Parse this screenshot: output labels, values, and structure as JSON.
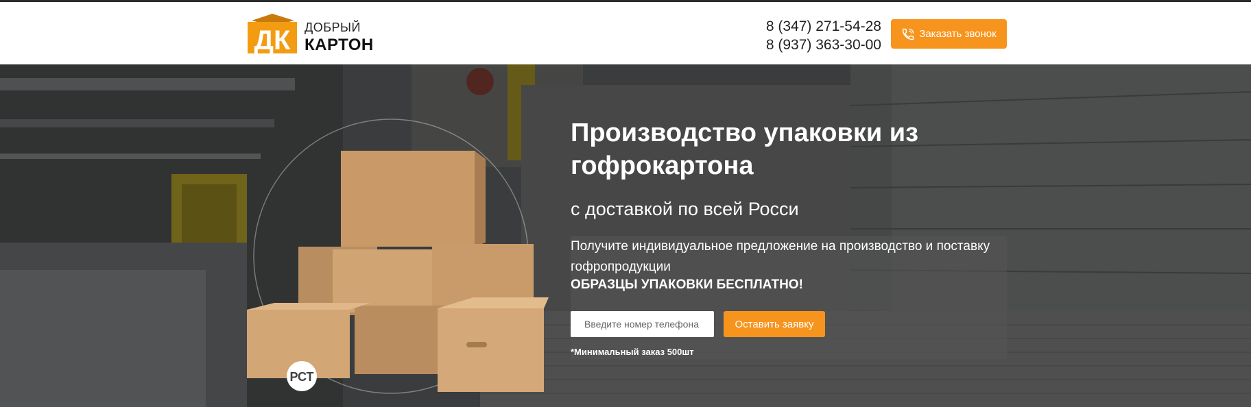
{
  "header": {
    "logo": {
      "line1": "ДОБРЫЙ",
      "line2": "КАРТОН",
      "mark": "ДК"
    },
    "phones": [
      "8 (347) 271-54-28",
      "8 (937) 363-30-00"
    ],
    "call_button": {
      "label": "Заказать звонок",
      "icon": "phone-icon"
    }
  },
  "hero": {
    "title": "Производство упаковки из гофрокартона",
    "subtitle": "с доставкой по всей Росси",
    "description": "Получите индивидуальное предложение на производство и поставку гофропродукции",
    "highlight": "ОБРАЗЦЫ УПАКОВКИ БЕСПЛАТНО!",
    "form": {
      "phone_placeholder": "Введите номер телефона",
      "submit_label": "Оставить заявку"
    },
    "note": "*Минимальный заказ 500шт",
    "badge": "РСТ"
  },
  "colors": {
    "accent": "#f7941d",
    "logo_orange": "#f39c12",
    "text_dark": "#222222"
  }
}
